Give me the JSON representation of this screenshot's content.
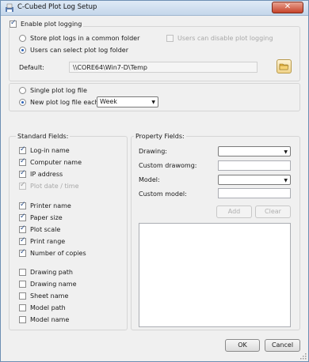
{
  "window": {
    "title": "C-Cubed Plot Log Setup",
    "close_label": "✕"
  },
  "logging": {
    "enable_label": "Enable plot logging",
    "store_common_label": "Store plot logs in a common folder",
    "users_disable_label": "Users can disable plot logging",
    "users_select_label": "Users can select plot log folder",
    "default_label": "Default:",
    "default_path": "\\\\CORE64\\Win7-D\\Temp"
  },
  "file_mode": {
    "single_label": "Single plot log file",
    "new_each_label": "New plot log file each",
    "period_value": "Week"
  },
  "standard": {
    "header": "Standard Fields:",
    "group1": [
      {
        "label": "Log-in name",
        "checked": true,
        "disabled": false
      },
      {
        "label": "Computer name",
        "checked": true,
        "disabled": false
      },
      {
        "label": "IP address",
        "checked": true,
        "disabled": false
      },
      {
        "label": "Plot date / time",
        "checked": true,
        "disabled": true
      }
    ],
    "group2": [
      {
        "label": "Printer name",
        "checked": true,
        "disabled": false
      },
      {
        "label": "Paper size",
        "checked": true,
        "disabled": false
      },
      {
        "label": "Plot scale",
        "checked": true,
        "disabled": false
      },
      {
        "label": "Print range",
        "checked": true,
        "disabled": false
      },
      {
        "label": "Number of copies",
        "checked": true,
        "disabled": false
      }
    ],
    "group3": [
      {
        "label": "Drawing path",
        "checked": false,
        "disabled": false
      },
      {
        "label": "Drawing name",
        "checked": false,
        "disabled": false
      },
      {
        "label": "Sheet name",
        "checked": false,
        "disabled": false
      },
      {
        "label": "Model path",
        "checked": false,
        "disabled": false
      },
      {
        "label": "Model name",
        "checked": false,
        "disabled": false
      }
    ]
  },
  "property": {
    "header": "Property Fields:",
    "drawing_label": "Drawing:",
    "custom_drawing_label": "Custom drawomg:",
    "model_label": "Model:",
    "custom_model_label": "Custom model:",
    "add_label": "Add",
    "clear_label": "Clear"
  },
  "footer": {
    "ok_label": "OK",
    "cancel_label": "Cancel"
  },
  "colors": {
    "title_gradient_top": "#dfeaf6",
    "close_red": "#c7432a",
    "check_blue": "#2a4f8a",
    "folder_yellow": "#f1d48a"
  }
}
